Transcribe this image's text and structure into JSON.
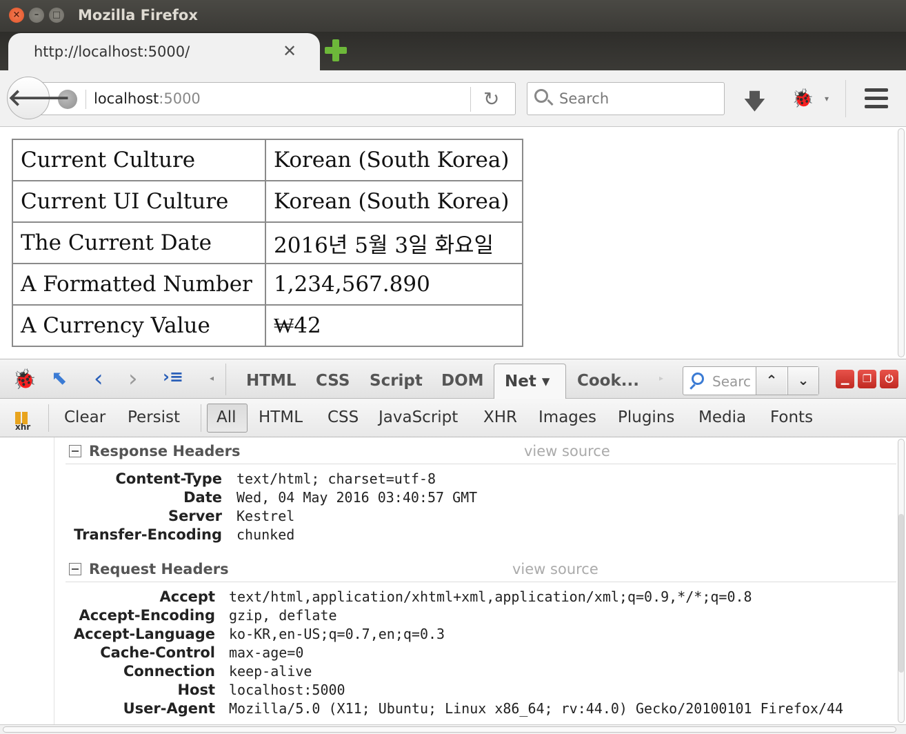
{
  "window": {
    "title": "Mozilla Firefox"
  },
  "tab": {
    "title": "http://localhost:5000/",
    "close_label": "✕"
  },
  "navbar": {
    "url_host": "localhost",
    "url_port": ":5000",
    "search_placeholder": "Search"
  },
  "page": {
    "rows": [
      {
        "key": "Current Culture",
        "value": "Korean (South Korea)"
      },
      {
        "key": "Current UI Culture",
        "value": "Korean (South Korea)"
      },
      {
        "key": "The Current Date",
        "value": "2016년 5월 3일 화요일"
      },
      {
        "key": "A Formatted Number",
        "value": "1,234,567.890"
      },
      {
        "key": "A Currency Value",
        "value": "₩42"
      }
    ]
  },
  "firebug": {
    "tabs": {
      "html": "HTML",
      "css": "CSS",
      "script": "Script",
      "dom": "DOM",
      "net": "Net ▾",
      "cookies": "Cook..."
    },
    "search_placeholder": "Searc",
    "filters": {
      "clear": "Clear",
      "persist": "Persist",
      "all": "All",
      "html": "HTML",
      "css": "CSS",
      "javascript": "JavaScript",
      "xhr": "XHR",
      "images": "Images",
      "plugins": "Plugins",
      "media": "Media",
      "fonts": "Fonts"
    },
    "xhr_label": "xhr"
  },
  "net": {
    "response": {
      "title": "Response Headers",
      "view_source": "view source",
      "headers": [
        {
          "name": "Content-Type",
          "value": "text/html; charset=utf-8"
        },
        {
          "name": "Date",
          "value": "Wed, 04 May 2016 03:40:57 GMT"
        },
        {
          "name": "Server",
          "value": "Kestrel"
        },
        {
          "name": "Transfer-Encoding",
          "value": "chunked"
        }
      ]
    },
    "request": {
      "title": "Request Headers",
      "view_source": "view source",
      "headers": [
        {
          "name": "Accept",
          "value": "text/html,application/xhtml+xml,application/xml;q=0.9,*/*;q=0.8"
        },
        {
          "name": "Accept-Encoding",
          "value": "gzip, deflate"
        },
        {
          "name": "Accept-Language",
          "value": "ko-KR,en-US;q=0.7,en;q=0.3"
        },
        {
          "name": "Cache-Control",
          "value": "max-age=0"
        },
        {
          "name": "Connection",
          "value": "keep-alive"
        },
        {
          "name": "Host",
          "value": "localhost:5000"
        },
        {
          "name": "User-Agent",
          "value": "Mozilla/5.0 (X11; Ubuntu; Linux x86_64; rv:44.0) Gecko/20100101 Firefox/44"
        }
      ]
    }
  }
}
